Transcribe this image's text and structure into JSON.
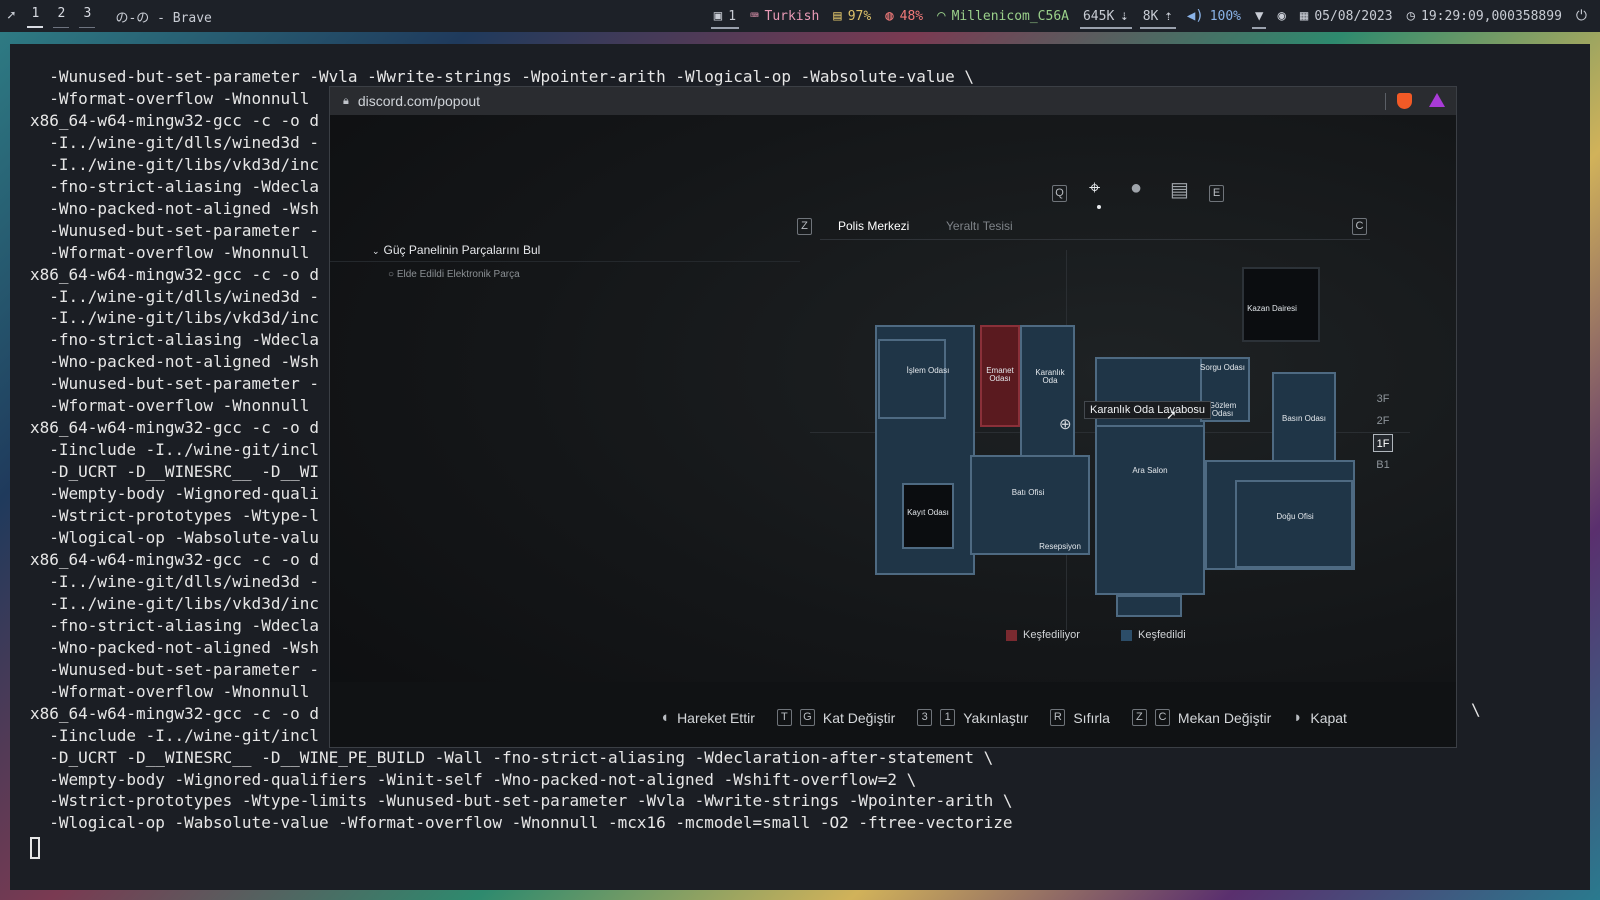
{
  "topbar": {
    "launcher_icon": "rocket-icon",
    "workspaces": [
      "1",
      "2",
      "3"
    ],
    "window_title": "の-の - Brave",
    "window_count": "1",
    "keyboard_layout": "Turkish",
    "cpu": "97%",
    "memory": "48%",
    "wifi_name": "Millenicom_C56A",
    "net_down": "645K",
    "net_up": "8K",
    "volume": "100%",
    "date": "05/08/2023",
    "time": "19:29:09,000358899"
  },
  "terminal": {
    "lines": [
      "  -Wunused-but-set-parameter -Wvla -Wwrite-strings -Wpointer-arith -Wlogical-op -Wabsolute-value \\",
      "  -Wformat-overflow -Wnonnull",
      "x86_64-w64-mingw32-gcc -c -o d",
      "  -I../wine-git/dlls/wined3d -",
      "  -I../wine-git/libs/vkd3d/inc",
      "  -fno-strict-aliasing -Wdecla",
      "  -Wno-packed-not-aligned -Wsh",
      "  -Wunused-but-set-parameter -",
      "  -Wformat-overflow -Wnonnull ",
      "x86_64-w64-mingw32-gcc -c -o d",
      "  -I../wine-git/dlls/wined3d -",
      "  -I../wine-git/libs/vkd3d/inc",
      "  -fno-strict-aliasing -Wdecla",
      "  -Wno-packed-not-aligned -Wsh",
      "  -Wunused-but-set-parameter -",
      "  -Wformat-overflow -Wnonnull ",
      "x86_64-w64-mingw32-gcc -c -o d",
      "  -Iinclude -I../wine-git/incl",
      "  -D_UCRT -D__WINESRC__ -D__WI",
      "  -Wempty-body -Wignored-quali",
      "  -Wstrict-prototypes -Wtype-l",
      "  -Wlogical-op -Wabsolute-valu",
      "x86_64-w64-mingw32-gcc -c -o d",
      "  -I../wine-git/dlls/wined3d -",
      "  -I../wine-git/libs/vkd3d/inc",
      "  -fno-strict-aliasing -Wdecla",
      "  -Wno-packed-not-aligned -Wsh",
      "  -Wunused-but-set-parameter -",
      "  -Wformat-overflow -Wnonnull ",
      "x86_64-w64-mingw32-gcc -c -o d",
      "  -Iinclude -I../wine-git/incl",
      "  -D_UCRT -D__WINESRC__ -D__WINE_PE_BUILD -Wall -fno-strict-aliasing -Wdeclaration-after-statement \\",
      "  -Wempty-body -Wignored-qualifiers -Winit-self -Wno-packed-not-aligned -Wshift-overflow=2 \\",
      "  -Wstrict-prototypes -Wtype-limits -Wunused-but-set-parameter -Wvla -Wwrite-strings -Wpointer-arith \\",
      "  -Wlogical-op -Wabsolute-value -Wformat-overflow -Wnonnull -mcx16 -mcmodel=small -O2 -ftree-vectorize"
    ],
    "trailing_backslash": "\\"
  },
  "browser": {
    "url": "discord.com/popout"
  },
  "game": {
    "top_keys": {
      "left": "Q",
      "right": "E"
    },
    "area_key_left": "Z",
    "area_key_right": "C",
    "area_tabs": [
      "Polis Merkezi",
      "Yeraltı Tesisi"
    ],
    "objective": "Güç Panelinin Parçalarını Bul",
    "sub_objective": "Elde Edildi Elektronik Parça",
    "tooltip": "Karanlık Oda Lavabosu",
    "floors": [
      "3F",
      "2F",
      "1F",
      "B1"
    ],
    "active_floor": "1F",
    "rooms": {
      "islem": "İşlem Odası",
      "emanet": "Emanet Odası",
      "karanlik": "Karanlık Oda",
      "sorgu": "Sorgu Odası",
      "gozlem": "Gözlem Odası",
      "basin": "Basın Odası",
      "kazan": "Kazan Dairesi",
      "ara_salon": "Ara Salon",
      "bati": "Batı Ofisi",
      "kayit": "Kayıt Odası",
      "resepsiyon": "Resepsiyon",
      "dogu": "Doğu Ofisi"
    },
    "legend": {
      "exploring": "Keşfediliyor",
      "explored": "Keşfedildi"
    },
    "controls": {
      "move": "Hareket Ettir",
      "key_t": "T",
      "key_g": "G",
      "floor": "Kat Değiştir",
      "key_3": "3",
      "key_1": "1",
      "zoom": "Yakınlaştır",
      "key_r": "R",
      "reset": "Sıfırla",
      "key_z": "Z",
      "key_c": "C",
      "area": "Mekan Değiştir",
      "close": "Kapat"
    }
  }
}
